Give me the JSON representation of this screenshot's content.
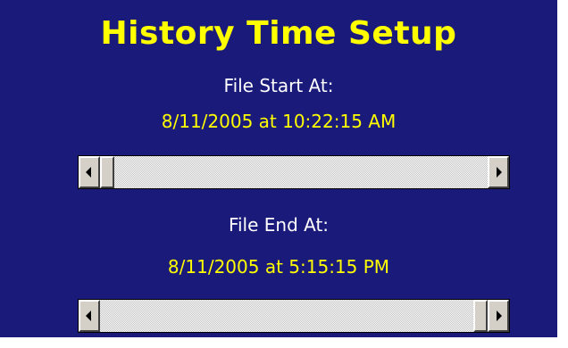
{
  "panel": {
    "title": "History Time Setup",
    "file_start": {
      "label": "File Start At:",
      "value": "8/11/2005 at 10:22:15 AM",
      "scroll_position": 0.0
    },
    "file_end": {
      "label": "File End At:",
      "value": "8/11/2005 at 5:15:15 PM",
      "scroll_position": 1.0
    }
  },
  "colors": {
    "background": "#1a1a7a",
    "title": "#ffff00",
    "label": "#ffffff",
    "value": "#ffff00"
  },
  "icons": {
    "scroll_left": "left-arrow-icon",
    "scroll_right": "right-arrow-icon"
  }
}
